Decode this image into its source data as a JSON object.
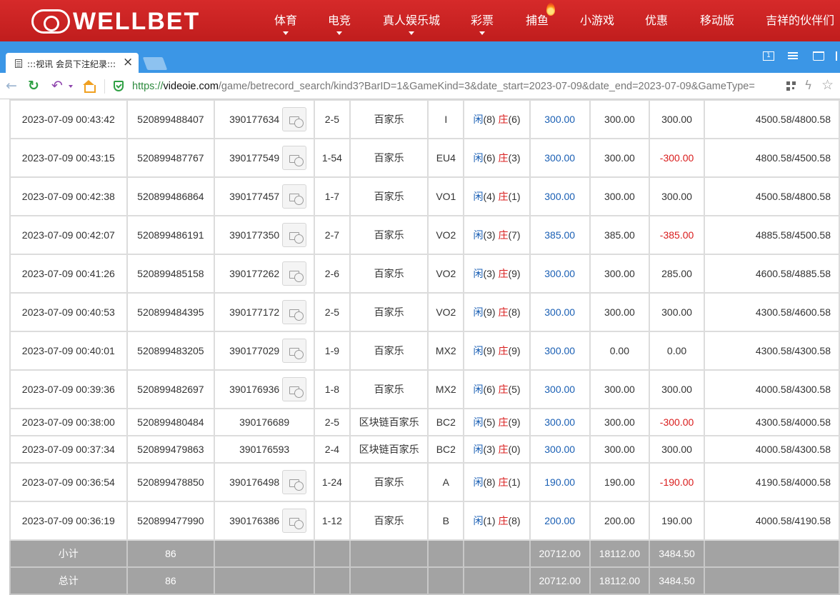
{
  "site_nav": {
    "logo_text": "WELLBET",
    "items": [
      {
        "label": "体育"
      },
      {
        "label": "电竞"
      },
      {
        "label": "真人娱乐城"
      },
      {
        "label": "彩票"
      },
      {
        "label": "捕鱼"
      },
      {
        "label": "小游戏"
      },
      {
        "label": "优惠"
      },
      {
        "label": "移动版"
      },
      {
        "label": "吉祥的伙伴们"
      }
    ]
  },
  "browser": {
    "tab_title": ":::视讯 会员下注纪录:::",
    "badge_number": "1",
    "url_protocol": "https://",
    "url_host": "videoie.com",
    "url_path": "/game/betrecord_search/kind3?BarID=1&GameKind=3&date_start=2023-07-09&date_end=2023-07-09&GameType="
  },
  "rows": [
    {
      "time": "2023-07-09 00:43:42",
      "bet_no": "520899488407",
      "game_no": "390177634",
      "round": "2-5",
      "game": "百家乐",
      "table": "I",
      "player": "(8)",
      "banker": "(6)",
      "bet": "300.00",
      "valid": "300.00",
      "result": "300.00",
      "balance": "4500.58/4800.58",
      "video": true,
      "negative": false
    },
    {
      "time": "2023-07-09 00:43:15",
      "bet_no": "520899487767",
      "game_no": "390177549",
      "round": "1-54",
      "game": "百家乐",
      "table": "EU4",
      "player": "(6)",
      "banker": "(3)",
      "bet": "300.00",
      "valid": "300.00",
      "result": "-300.00",
      "balance": "4800.58/4500.58",
      "video": true,
      "negative": true
    },
    {
      "time": "2023-07-09 00:42:38",
      "bet_no": "520899486864",
      "game_no": "390177457",
      "round": "1-7",
      "game": "百家乐",
      "table": "VO1",
      "player": "(4)",
      "banker": "(1)",
      "bet": "300.00",
      "valid": "300.00",
      "result": "300.00",
      "balance": "4500.58/4800.58",
      "video": true,
      "negative": false
    },
    {
      "time": "2023-07-09 00:42:07",
      "bet_no": "520899486191",
      "game_no": "390177350",
      "round": "2-7",
      "game": "百家乐",
      "table": "VO2",
      "player": "(3)",
      "banker": "(7)",
      "bet": "385.00",
      "valid": "385.00",
      "result": "-385.00",
      "balance": "4885.58/4500.58",
      "video": true,
      "negative": true
    },
    {
      "time": "2023-07-09 00:41:26",
      "bet_no": "520899485158",
      "game_no": "390177262",
      "round": "2-6",
      "game": "百家乐",
      "table": "VO2",
      "player": "(3)",
      "banker": "(9)",
      "bet": "300.00",
      "valid": "300.00",
      "result": "285.00",
      "balance": "4600.58/4885.58",
      "video": true,
      "negative": false
    },
    {
      "time": "2023-07-09 00:40:53",
      "bet_no": "520899484395",
      "game_no": "390177172",
      "round": "2-5",
      "game": "百家乐",
      "table": "VO2",
      "player": "(9)",
      "banker": "(8)",
      "bet": "300.00",
      "valid": "300.00",
      "result": "300.00",
      "balance": "4300.58/4600.58",
      "video": true,
      "negative": false
    },
    {
      "time": "2023-07-09 00:40:01",
      "bet_no": "520899483205",
      "game_no": "390177029",
      "round": "1-9",
      "game": "百家乐",
      "table": "MX2",
      "player": "(9)",
      "banker": "(9)",
      "bet": "300.00",
      "valid": "0.00",
      "result": "0.00",
      "balance": "4300.58/4300.58",
      "video": true,
      "negative": false
    },
    {
      "time": "2023-07-09 00:39:36",
      "bet_no": "520899482697",
      "game_no": "390176936",
      "round": "1-8",
      "game": "百家乐",
      "table": "MX2",
      "player": "(6)",
      "banker": "(5)",
      "bet": "300.00",
      "valid": "300.00",
      "result": "300.00",
      "balance": "4000.58/4300.58",
      "video": true,
      "negative": false
    },
    {
      "time": "2023-07-09 00:38:00",
      "bet_no": "520899480484",
      "game_no": "390176689",
      "round": "2-5",
      "game": "区块链百家乐",
      "table": "BC2",
      "player": "(5)",
      "banker": "(9)",
      "bet": "300.00",
      "valid": "300.00",
      "result": "-300.00",
      "balance": "4300.58/4000.58",
      "video": false,
      "negative": true
    },
    {
      "time": "2023-07-09 00:37:34",
      "bet_no": "520899479863",
      "game_no": "390176593",
      "round": "2-4",
      "game": "区块链百家乐",
      "table": "BC2",
      "player": "(3)",
      "banker": "(0)",
      "bet": "300.00",
      "valid": "300.00",
      "result": "300.00",
      "balance": "4000.58/4300.58",
      "video": false,
      "negative": false
    },
    {
      "time": "2023-07-09 00:36:54",
      "bet_no": "520899478850",
      "game_no": "390176498",
      "round": "1-24",
      "game": "百家乐",
      "table": "A",
      "player": "(8)",
      "banker": "(1)",
      "bet": "190.00",
      "valid": "190.00",
      "result": "-190.00",
      "balance": "4190.58/4000.58",
      "video": true,
      "negative": true
    },
    {
      "time": "2023-07-09 00:36:19",
      "bet_no": "520899477990",
      "game_no": "390176386",
      "round": "1-12",
      "game": "百家乐",
      "table": "B",
      "player": "(1)",
      "banker": "(8)",
      "bet": "200.00",
      "valid": "200.00",
      "result": "190.00",
      "balance": "4000.58/4190.58",
      "video": true,
      "negative": false
    }
  ],
  "labels": {
    "player": "闲",
    "banker": "庄"
  },
  "subtotal": {
    "label": "小计",
    "count": "86",
    "bet": "20712.00",
    "valid": "18112.00",
    "result": "3484.50"
  },
  "total": {
    "label": "总计",
    "count": "86",
    "bet": "20712.00",
    "valid": "18112.00",
    "result": "3484.50"
  },
  "colors": {
    "nav_red": "#c92323",
    "tab_blue": "#3b96e6",
    "bet_blue": "#1a5fb4",
    "loss_red": "#d91c1c",
    "summary_gray": "#a3a3a3"
  }
}
